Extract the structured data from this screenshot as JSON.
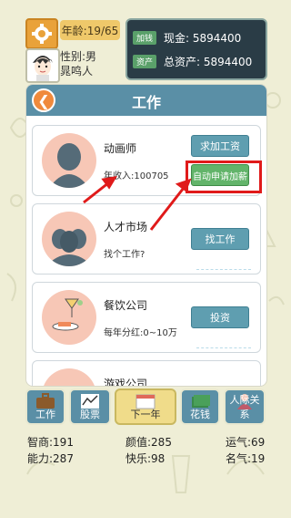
{
  "header": {
    "age_label": "年龄:19/65",
    "gender": "性别:男",
    "player_name": "晁鸣人",
    "cash_tag": "加钱",
    "cash_value": "现金: 5894400",
    "assets_tag": "资产",
    "assets_value": "总资产: 5894400"
  },
  "page": {
    "title": "工作",
    "back_icon": "arrow-left-icon"
  },
  "cards": [
    {
      "title": "动画师",
      "subtitle": "年收入:100705",
      "buttons": [
        "求加工资",
        "自动申请加薪"
      ]
    },
    {
      "title": "人才市场",
      "subtitle": "找个工作?",
      "buttons": [
        "找工作"
      ]
    },
    {
      "title": "餐饮公司",
      "subtitle": "每年分红:0~10万",
      "buttons": [
        "投资"
      ]
    },
    {
      "title": "游戏公司"
    }
  ],
  "bottom_nav": [
    "工作",
    "股票",
    "下一年",
    "花钱",
    "人际关系"
  ],
  "stats": {
    "intelligence": "智商:191",
    "looks": "颜值:285",
    "luck": "运气:69",
    "ability": "能力:287",
    "happiness": "快乐:98",
    "fame": "名气:19"
  },
  "colors": {
    "highlight": "#e01a1a",
    "nav_blue": "#5a8fa6",
    "next_year_yellow": "#f0dc8a"
  }
}
